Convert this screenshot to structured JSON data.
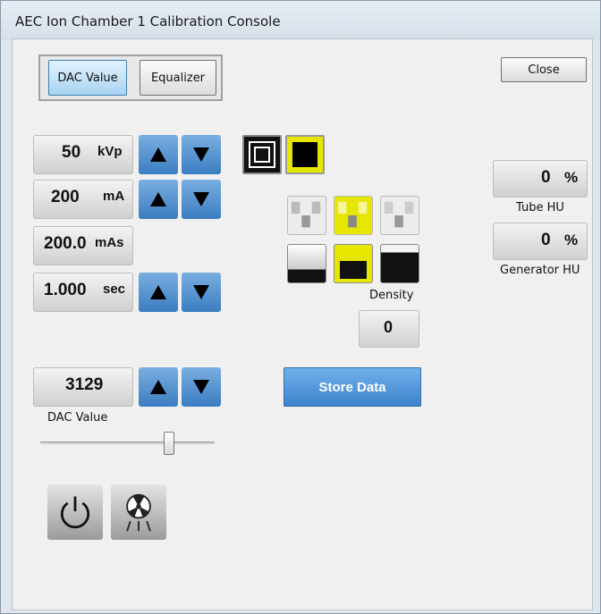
{
  "window": {
    "title": "AEC Ion Chamber 1 Calibration Console"
  },
  "tabs": {
    "dac_value": "DAC Value",
    "equalizer": "Equalizer"
  },
  "close_label": "Close",
  "kvp": {
    "value": "50",
    "unit": "kVp"
  },
  "ma": {
    "value": "200",
    "unit": "mA"
  },
  "mas": {
    "value": "200.0",
    "unit": "mAs"
  },
  "time": {
    "value": "1.000",
    "unit": "sec"
  },
  "dac": {
    "value": "3129",
    "label": "DAC Value",
    "slider_fraction": 0.74
  },
  "density": {
    "label": "Density",
    "value": "0"
  },
  "store_label": "Store Data",
  "tube_hu": {
    "value": "0",
    "unit": "%",
    "label": "Tube HU"
  },
  "generator_hu": {
    "value": "0",
    "unit": "%",
    "label": "Generator HU"
  },
  "colors": {
    "accent_blue": "#3b7dc2",
    "selected_yellow": "#e6e600"
  },
  "icons": {
    "up": "arrow-up-icon",
    "down": "arrow-down-icon",
    "power": "power-icon",
    "radiation": "radiation-icon"
  }
}
